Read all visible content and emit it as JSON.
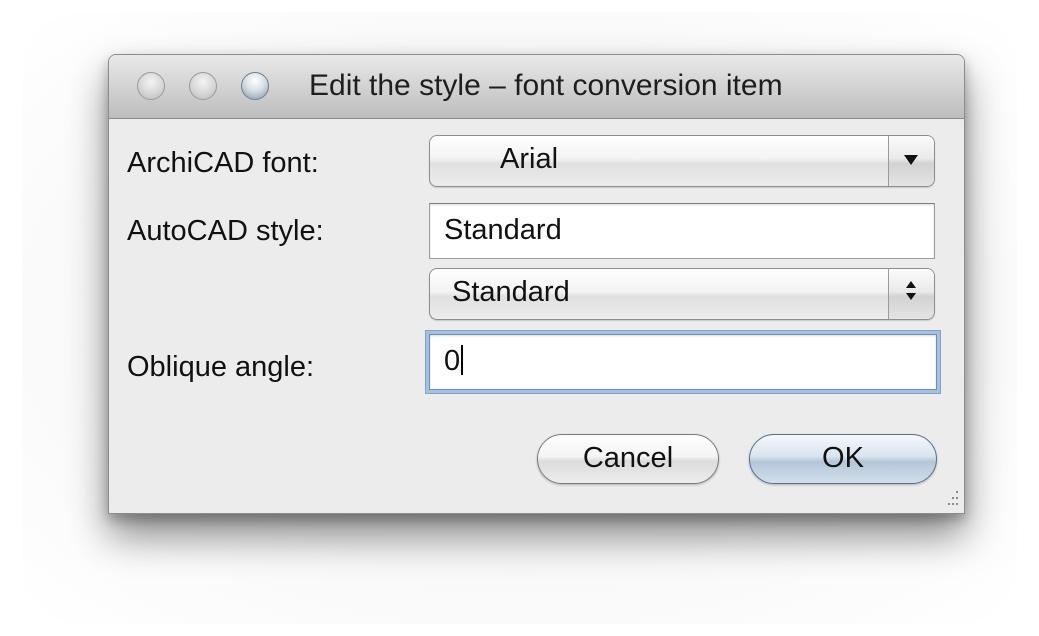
{
  "window": {
    "title": "Edit the style – font conversion item"
  },
  "form": {
    "archicad_font_label": "ArchiCAD font:",
    "archicad_font_value": "Arial",
    "autocad_style_label": "AutoCAD style:",
    "autocad_style_value": "Standard",
    "style_popup_value": "Standard",
    "oblique_angle_label": "Oblique angle:",
    "oblique_angle_value": "0"
  },
  "buttons": {
    "cancel_label": "Cancel",
    "ok_label": "OK"
  },
  "icons": {
    "close": "close-traffic-light",
    "minimize": "minimize-traffic-light",
    "zoom": "zoom-traffic-light",
    "popup_arrow": "chevron-down-icon",
    "stepper_arrows": "up-down-arrows-icon",
    "resize_grip": "resize-grip-icon"
  }
}
